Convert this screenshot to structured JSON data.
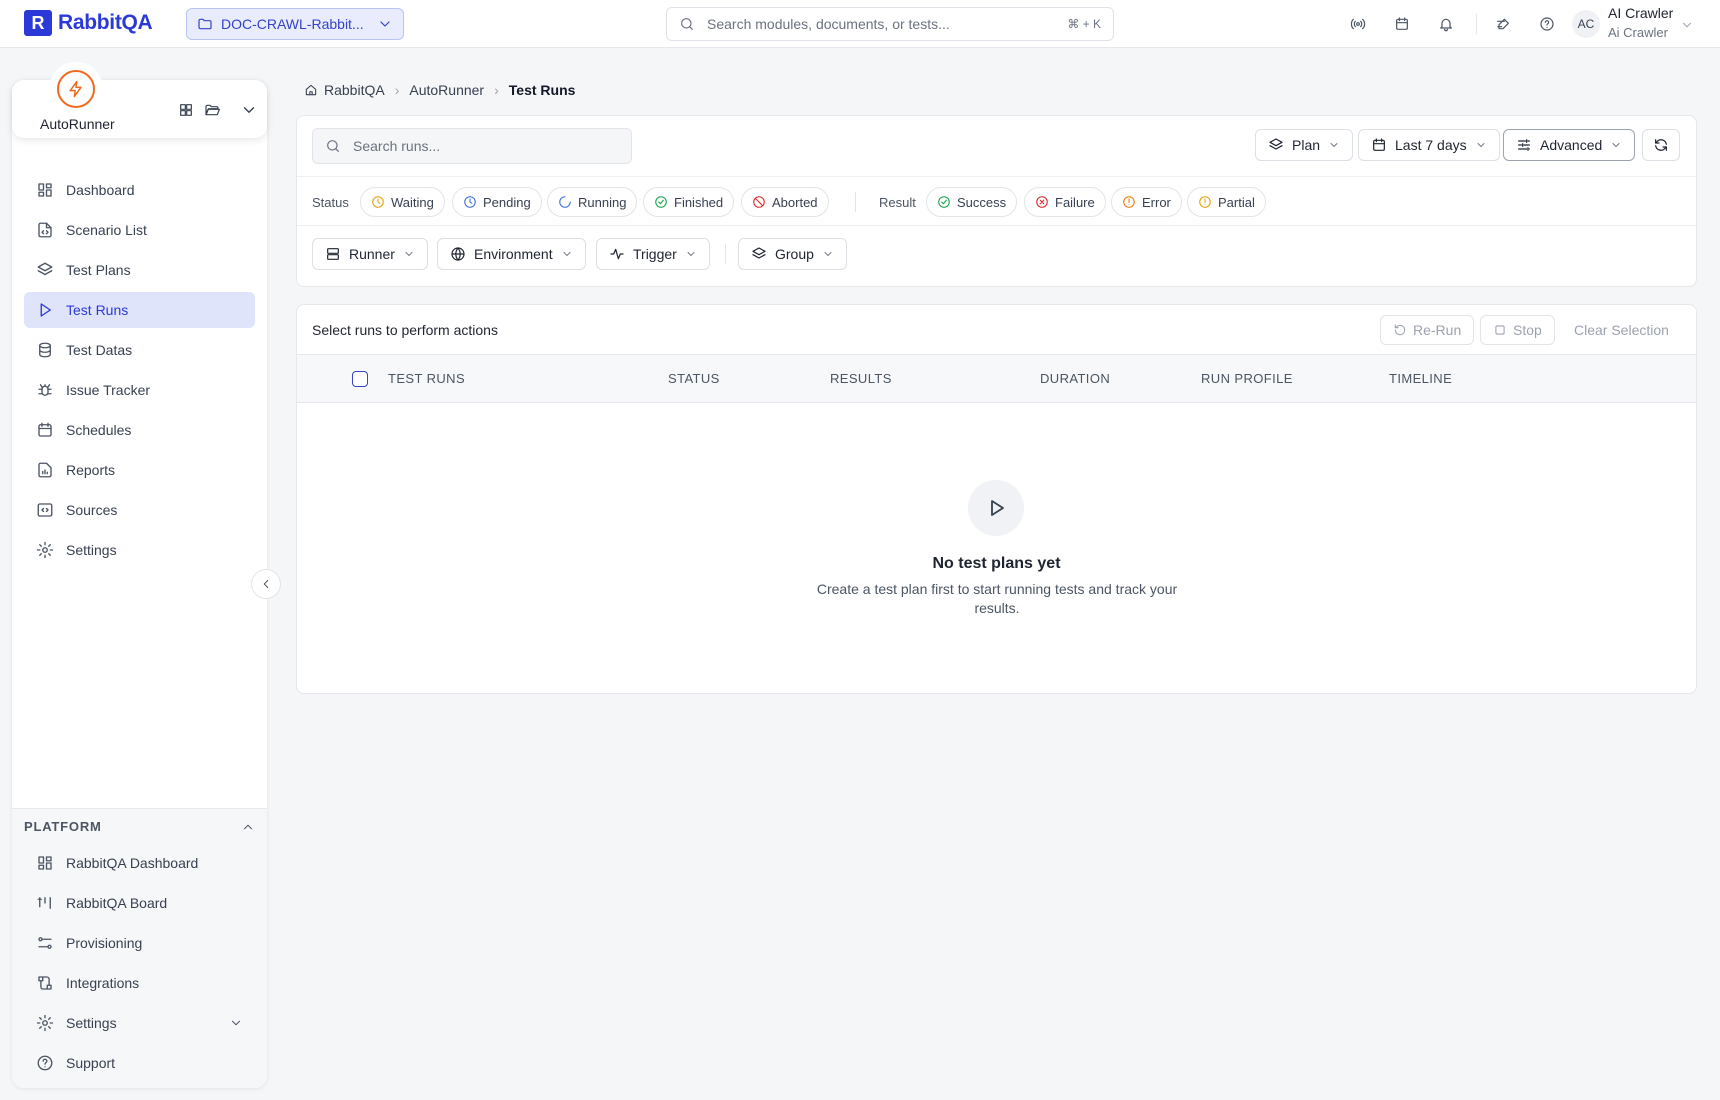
{
  "app": {
    "logo_letter": "R",
    "logo_text": "RabbitQA",
    "project": "DOC-CRAWL-Rabbit...",
    "search_placeholder": "Search modules, documents, or tests...",
    "search_shortcut": "⌘ + K",
    "user": {
      "initials": "AC",
      "name": "AI Crawler",
      "role": "Ai Crawler"
    },
    "accent_color": "#2b3ad6",
    "module_color": "#f06a1d"
  },
  "sidebar": {
    "module_name": "AutoRunner",
    "items": [
      {
        "label": "Dashboard",
        "icon": "dashboard-icon"
      },
      {
        "label": "Scenario List",
        "icon": "file-code-icon"
      },
      {
        "label": "Test Plans",
        "icon": "layers-icon"
      },
      {
        "label": "Test Runs",
        "icon": "play-icon",
        "active": true
      },
      {
        "label": "Test Datas",
        "icon": "database-icon"
      },
      {
        "label": "Issue Tracker",
        "icon": "bug-icon"
      },
      {
        "label": "Schedules",
        "icon": "calendar-icon"
      },
      {
        "label": "Reports",
        "icon": "report-icon"
      },
      {
        "label": "Sources",
        "icon": "code-icon"
      },
      {
        "label": "Settings",
        "icon": "gear-icon"
      }
    ],
    "platform": {
      "heading": "PLATFORM",
      "items": [
        {
          "label": "RabbitQA Dashboard",
          "icon": "dashboard-icon"
        },
        {
          "label": "RabbitQA Board",
          "icon": "board-icon"
        },
        {
          "label": "Provisioning",
          "icon": "provisioning-icon"
        },
        {
          "label": "Integrations",
          "icon": "integrations-icon"
        },
        {
          "label": "Settings",
          "icon": "gear-icon"
        },
        {
          "label": "Support",
          "icon": "help-icon"
        }
      ]
    }
  },
  "breadcrumb": [
    "RabbitQA",
    "AutoRunner",
    "Test Runs"
  ],
  "filters": {
    "search_placeholder": "Search runs...",
    "plan_label": "Plan",
    "range_label": "Last 7 days",
    "advanced_label": "Advanced",
    "status_label": "Status",
    "statuses": [
      {
        "label": "Waiting",
        "color": "#e0a106"
      },
      {
        "label": "Pending",
        "color": "#3b6fd8"
      },
      {
        "label": "Running",
        "color": "#3b6fd8"
      },
      {
        "label": "Finished",
        "color": "#16a34a"
      },
      {
        "label": "Aborted",
        "color": "#dc2626"
      }
    ],
    "result_label": "Result",
    "results": [
      {
        "label": "Success",
        "color": "#16a34a"
      },
      {
        "label": "Failure",
        "color": "#dc2626"
      },
      {
        "label": "Error",
        "color": "#ea7a0c"
      },
      {
        "label": "Partial",
        "color": "#e0a106"
      }
    ],
    "runner_label": "Runner",
    "environment_label": "Environment",
    "trigger_label": "Trigger",
    "group_label": "Group"
  },
  "table": {
    "actions_label": "Select runs to perform actions",
    "rerun_label": "Re-Run",
    "stop_label": "Stop",
    "clear_label": "Clear Selection",
    "columns": [
      "TEST RUNS",
      "STATUS",
      "RESULTS",
      "DURATION",
      "RUN PROFILE",
      "TIMELINE"
    ],
    "empty_title": "No test plans yet",
    "empty_text": "Create a test plan first to start running tests and track your results."
  }
}
